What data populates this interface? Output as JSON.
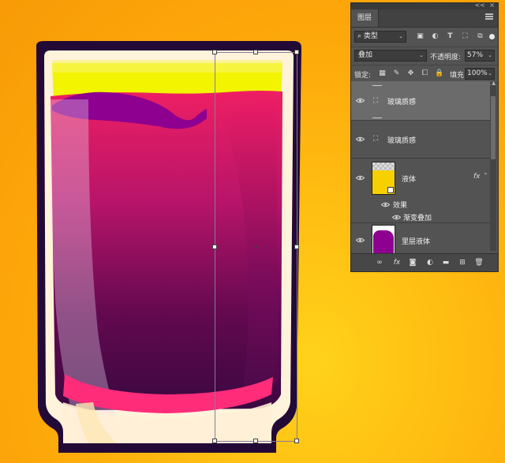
{
  "panel": {
    "tab_label": "图层",
    "collapse_label": "<<",
    "close_label": "×",
    "filter_select_value": "类型",
    "blend_mode": "叠加",
    "opacity_label": "不透明度:",
    "opacity_value": "57%",
    "lock_label": "锁定:",
    "fill_label": "填充:",
    "fill_value": "100%"
  },
  "layers": [
    {
      "name": "玻璃质感",
      "kind": "smart-object-group",
      "selected": true
    },
    {
      "name": "玻璃质感",
      "kind": "smart-object"
    },
    {
      "name": "液体",
      "kind": "pixel",
      "has_fx": true,
      "fx_label": "fx",
      "thumbnail_color": "#f7d000"
    },
    {
      "name": "效果",
      "kind": "effects-header"
    },
    {
      "name": "渐变叠加",
      "kind": "effect"
    },
    {
      "name": "里层液体",
      "kind": "pixel",
      "thumbnail_color": "#8d0090"
    }
  ],
  "colors": {
    "background_orange": "#fda70a",
    "cup_outline": "#230a36",
    "cup_cream": "#fff3dc",
    "liquid_yellow": "#f2f400",
    "liquid_purple": "#8d0090",
    "liquid_pink": "#e6185e",
    "panel_bg": "#535353"
  },
  "icons": {
    "filter": [
      "image-filter-icon",
      "adjustment-filter-icon",
      "type-filter-icon",
      "shape-filter-icon",
      "smart-object-filter-icon"
    ],
    "lock": [
      "lock-transparent-icon",
      "lock-pixels-icon",
      "lock-position-icon",
      "lock-artboard-icon",
      "lock-all-icon"
    ],
    "bottom": [
      "link-layers-icon",
      "fx-icon",
      "mask-icon",
      "adjustment-layer-icon",
      "folder-icon",
      "new-layer-icon",
      "trash-icon"
    ]
  }
}
